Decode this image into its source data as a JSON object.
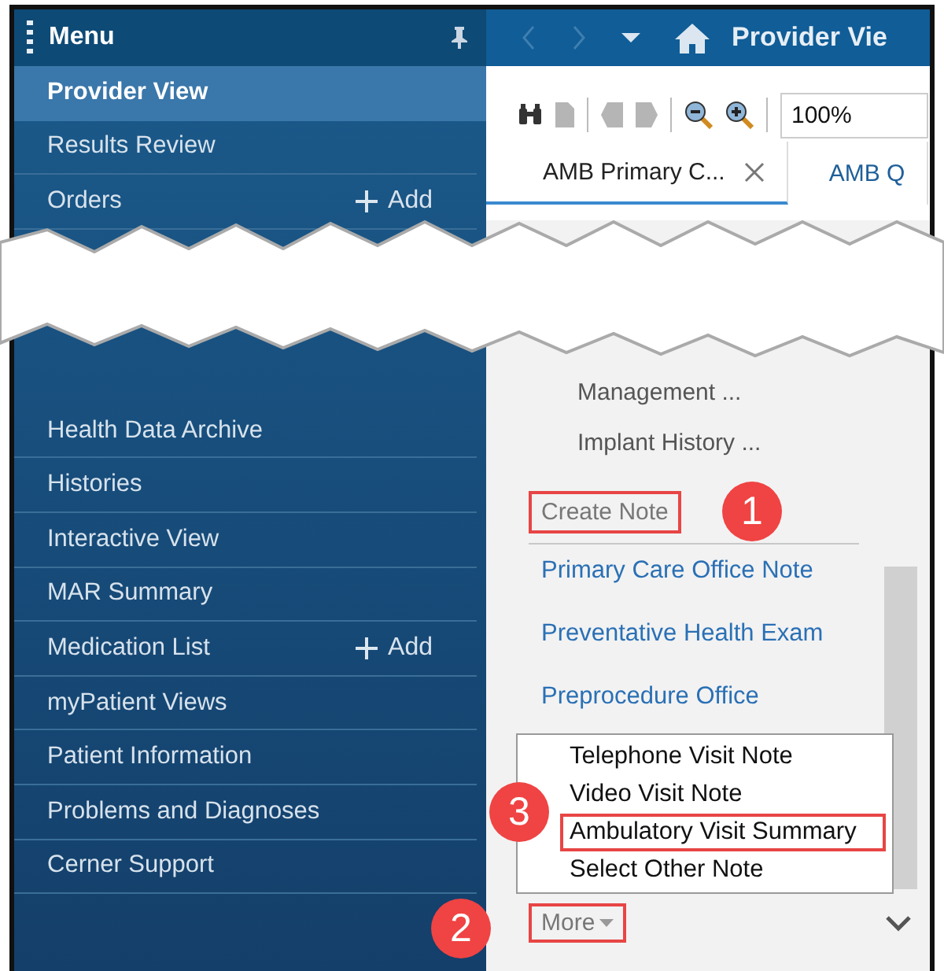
{
  "menu": {
    "title": "Menu",
    "items": [
      {
        "label": "Provider View",
        "selected": true
      },
      {
        "label": "Results Review",
        "selected": false
      },
      {
        "label": "Orders",
        "selected": false,
        "action": "Add"
      },
      {
        "kind": "hidden"
      },
      {
        "label": "Health Data Archive",
        "selected": false
      },
      {
        "label": "Histories",
        "selected": false
      },
      {
        "label": "Interactive View",
        "selected": false
      },
      {
        "label": "MAR Summary",
        "selected": false
      },
      {
        "label": "Medication List",
        "selected": false,
        "action": "Add"
      },
      {
        "label": "myPatient Views",
        "selected": false
      },
      {
        "label": "Patient Information",
        "selected": false
      },
      {
        "label": "Problems and Diagnoses",
        "selected": false
      },
      {
        "label": "Cerner Support",
        "selected": false
      }
    ]
  },
  "topbar": {
    "title": "Provider Vie"
  },
  "toolbar": {
    "zoom": "100%"
  },
  "tabs": [
    {
      "label": "AMB Primary C...",
      "selected": true,
      "closable": true
    },
    {
      "label": "AMB Q",
      "selected": false,
      "closable": false
    }
  ],
  "content": {
    "items": [
      "Management ...",
      "Implant History ..."
    ],
    "create_note": {
      "label": "Create Note",
      "highlighted": true
    },
    "links": [
      "Primary Care Office Note",
      "Preventative Health Exam",
      "Preprocedure Office"
    ],
    "more": {
      "label": "More",
      "highlighted": true
    }
  },
  "popup": {
    "items": [
      {
        "label": "Telephone Visit Note",
        "highlighted": false
      },
      {
        "label": "Video Visit Note",
        "highlighted": false
      },
      {
        "label": "Ambulatory Visit Summary",
        "highlighted": true
      },
      {
        "label": "Select Other Note",
        "highlighted": false
      }
    ]
  },
  "callouts": [
    "1",
    "2",
    "3"
  ]
}
